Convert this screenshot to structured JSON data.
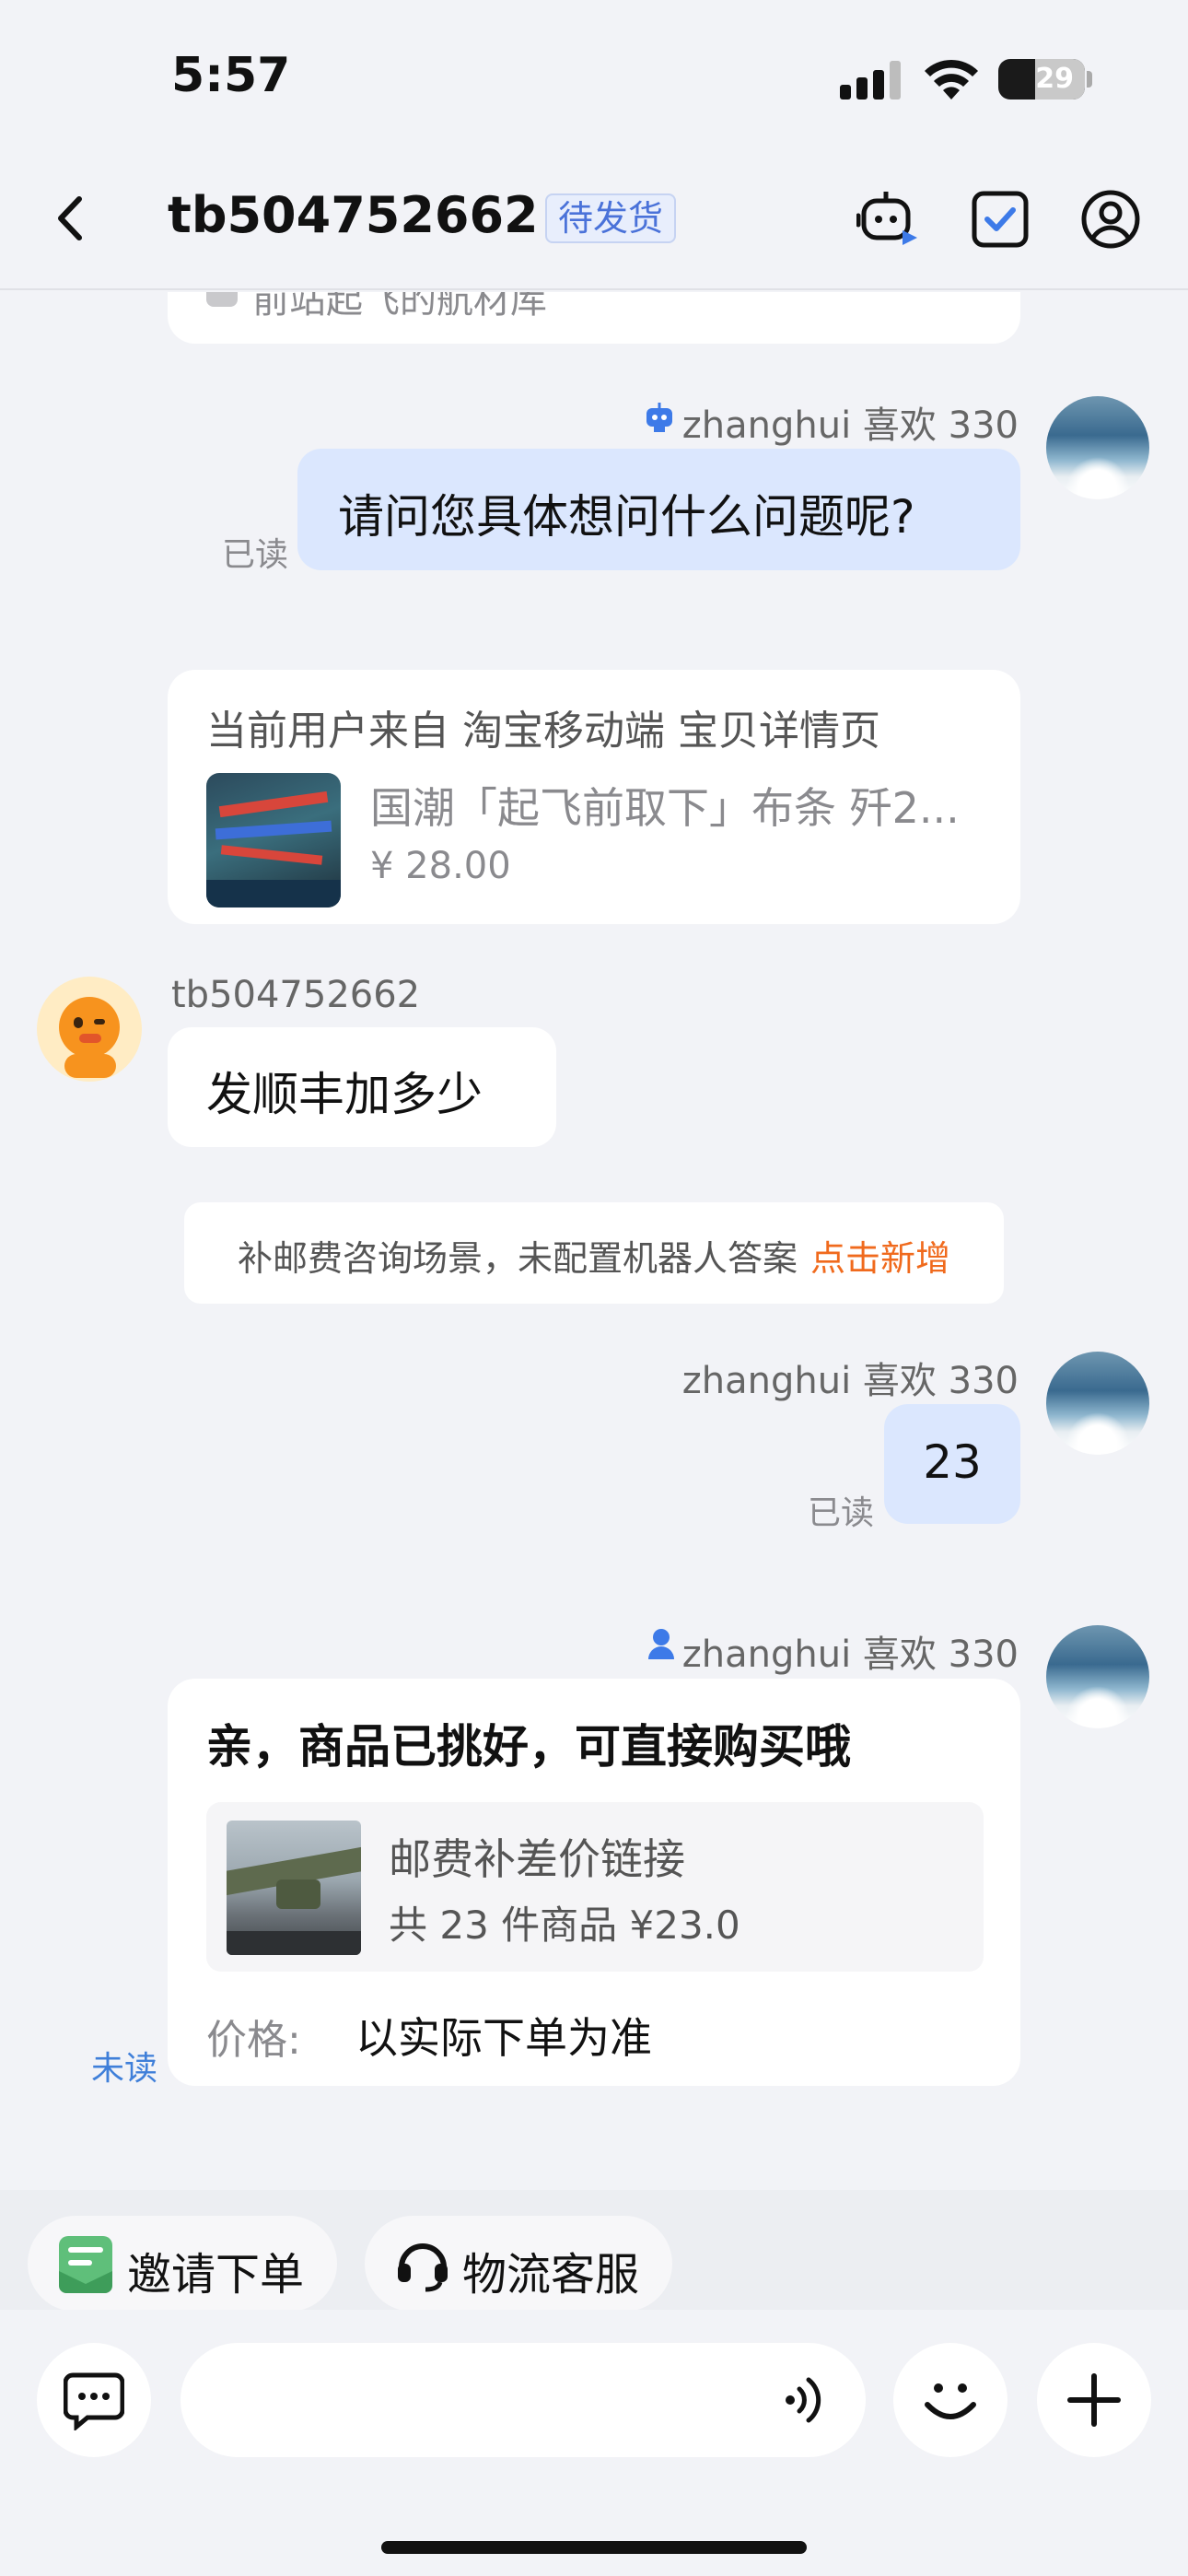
{
  "status_bar": {
    "time": "5:57",
    "battery": "29"
  },
  "header": {
    "title": "tb504752662",
    "badge": "待发货"
  },
  "messages": {
    "partial_card_text": "前站起飞的航材库",
    "m1": {
      "sender": "zhanghui 喜欢 330",
      "text": "请问您具体想问什么问题呢?",
      "read": "已读"
    },
    "source_card": {
      "label": "当前用户来自 淘宝移动端 宝贝详情页",
      "product_title": "国潮「起飞前取下」布条 歼2...",
      "price": "¥ 28.00"
    },
    "m2": {
      "sender": "tb504752662",
      "text": "发顺丰加多少"
    },
    "system_notice": {
      "text": "补邮费咨询场景，未配置机器人答案",
      "action": "点击新增"
    },
    "m3": {
      "sender": "zhanghui 喜欢 330",
      "text": "23",
      "read": "已读"
    },
    "m4": {
      "sender": "zhanghui 喜欢 330",
      "title": "亲，商品已挑好，可直接购买哦",
      "product_name": "邮费补差价链接",
      "product_summary": "共 23 件商品 ¥23.0",
      "price_label": "价格:",
      "price_value": "以实际下单为准",
      "status": "未读"
    }
  },
  "quick_actions": [
    {
      "label": "邀请下单",
      "icon": "order-invite-icon"
    },
    {
      "label": "物流客服",
      "icon": "headset-icon"
    }
  ],
  "colors": {
    "accent": "#4a72d9",
    "orange": "#f06a1d",
    "bubble_out": "#dbe7fe",
    "background": "#f2f3f7"
  }
}
